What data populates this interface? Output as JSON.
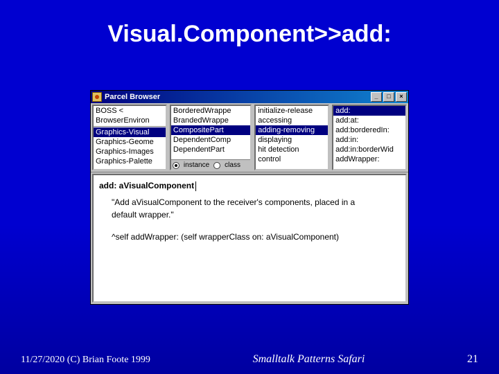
{
  "slide": {
    "title": "Visual.Component>>add:"
  },
  "window": {
    "title": "Parcel Browser",
    "btn_min": "_",
    "btn_max": "□",
    "btn_close": "×"
  },
  "pane1": {
    "items0": "BOSS  <",
    "items1": "BrowserEnviron",
    "items2": "Graphics-Visual",
    "items3": "Graphics-Geome",
    "items4": "Graphics-Images",
    "items5": "Graphics-Palette",
    "sel_index": 2
  },
  "pane2": {
    "items0": "BorderedWrappe",
    "items1": "BrandedWrappe",
    "items2": "CompositePart",
    "items3": "DependentComp",
    "items4": "DependentPart",
    "sel_index": 2,
    "radio_instance": "instance",
    "radio_class": "class"
  },
  "pane3": {
    "items0": "initialize-release",
    "items1": "accessing",
    "items2": "adding-removing",
    "items3": "displaying",
    "items4": "hit detection",
    "items5": "control",
    "sel_index": 2
  },
  "pane4": {
    "items0": "add:",
    "items1": "add:at:",
    "items2": "add:borderedIn:",
    "items3": "add:in:",
    "items4": "add:in:borderWid",
    "items5": "addWrapper:",
    "sel_index": 0
  },
  "code": {
    "signature": "add: aVisualComponent",
    "comment1": "\"Add aVisualComponent to the receiver's components, placed in a",
    "comment2": "default wrapper.\"",
    "body": "^self addWrapper: (self wrapperClass on: aVisualComponent)"
  },
  "footer": {
    "left": "11/27/2020 (C) Brian Foote 1999",
    "center": "Smalltalk Patterns Safari",
    "right": "21"
  }
}
